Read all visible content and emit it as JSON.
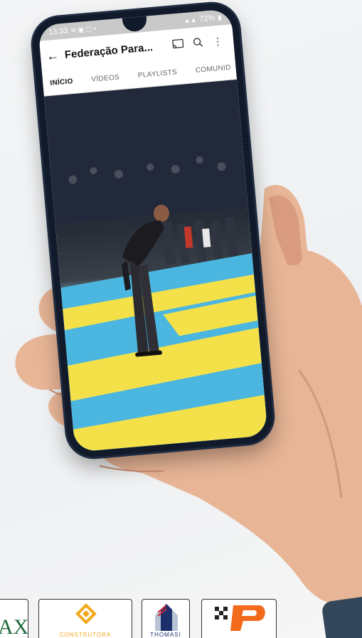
{
  "status_bar": {
    "time": "13:33",
    "battery": "72%"
  },
  "app_bar": {
    "title": "Federação Para...",
    "back_icon": "arrow-left-icon",
    "cast_icon": "cast-icon",
    "search_icon": "search-icon",
    "more_icon": "more-vert-icon"
  },
  "tabs": [
    {
      "label": "INÍCIO",
      "active": true
    },
    {
      "label": "VÍDEOS",
      "active": false
    },
    {
      "label": "PLAYLISTS",
      "active": false
    },
    {
      "label": "COMUNID",
      "active": false
    }
  ],
  "sponsors": [
    {
      "label": "AX",
      "color": "#1f6a3d"
    },
    {
      "label": "CONSTRUTORA",
      "color": "#f2a81d"
    },
    {
      "label": "THOMASI",
      "color": "#1b2f6b"
    },
    {
      "label": "P",
      "color": "#f26a1b"
    }
  ],
  "colors": {
    "mat_yellow": "#f4e14a",
    "mat_blue": "#46b6e0",
    "phone_body": "#111a2a",
    "status_bar": "#c9c9c9"
  }
}
